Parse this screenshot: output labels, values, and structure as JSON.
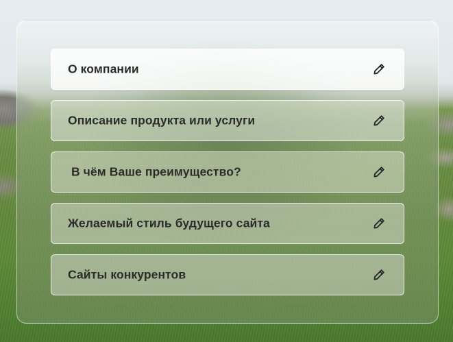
{
  "form": {
    "items": [
      {
        "label": "О компании",
        "icon": "pencil-icon"
      },
      {
        "label": "Описание продукта или услуги",
        "icon": "pencil-icon"
      },
      {
        "label": " В чём Ваше преимущество?",
        "icon": "pencil-icon"
      },
      {
        "label": "Желаемый стиль будущего сайта",
        "icon": "pencil-icon"
      },
      {
        "label": "Сайты конкурентов",
        "icon": "pencil-icon"
      }
    ]
  },
  "colors": {
    "text": "#2b2c2a",
    "icon": "#232323"
  }
}
